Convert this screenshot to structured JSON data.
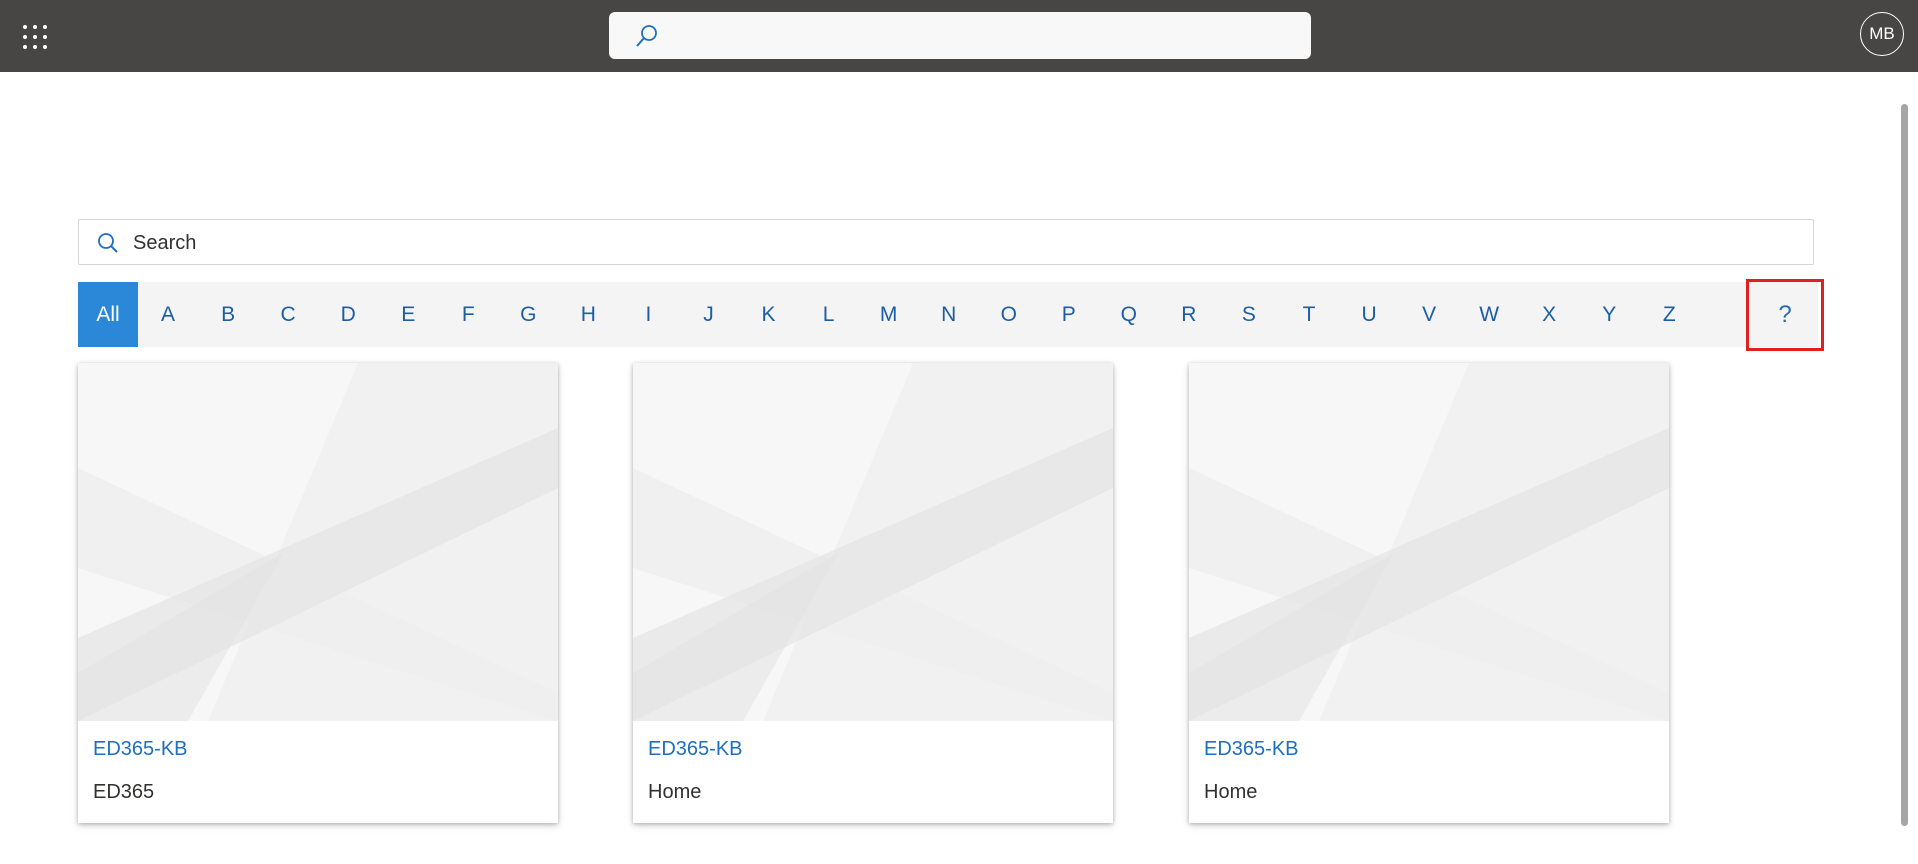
{
  "topbar": {
    "app_launcher_icon": "waffle-icon",
    "search_icon": "search-icon",
    "avatar_initials": "MB"
  },
  "search": {
    "placeholder": "Search"
  },
  "alphabet": {
    "items": [
      "All",
      "A",
      "B",
      "C",
      "D",
      "E",
      "F",
      "G",
      "H",
      "I",
      "J",
      "K",
      "L",
      "M",
      "N",
      "O",
      "P",
      "Q",
      "R",
      "S",
      "T",
      "U",
      "V",
      "W",
      "X",
      "Y",
      "Z"
    ],
    "selected": "All",
    "help_label": "?"
  },
  "cards": [
    {
      "title": "ED365-KB",
      "subtitle": "ED365"
    },
    {
      "title": "ED365-KB",
      "subtitle": "Home"
    },
    {
      "title": "ED365-KB",
      "subtitle": "Home"
    }
  ],
  "colors": {
    "topbar": "#484644",
    "accent": "#2b88d8",
    "link": "#1e6fc0",
    "highlight": "#e01f1f"
  }
}
